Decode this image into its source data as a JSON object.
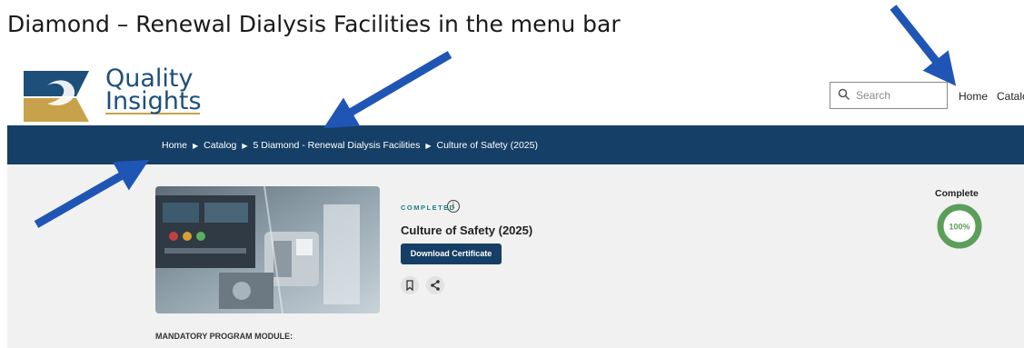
{
  "caption": "Diamond – Renewal Dialysis Facilities in the menu bar",
  "logo": {
    "line1": "Quality",
    "line2": "Insights"
  },
  "search": {
    "placeholder": "Search"
  },
  "nav": {
    "home": "Home",
    "catalog": "Catalo"
  },
  "breadcrumb": [
    "Home",
    "Catalog",
    "5 Diamond - Renewal Dialysis Facilities",
    "Culture of Safety (2025)"
  ],
  "course": {
    "status": "COMPLETED",
    "title": "Culture of Safety (2025)",
    "download_label": "Download Certificate"
  },
  "progress": {
    "label": "Complete",
    "value_text": "100%",
    "percent": 100
  },
  "section_heading": "MANDATORY PROGRAM MODULE:",
  "colors": {
    "brand_navy": "#153f66",
    "complete_green": "#5a9e5a",
    "arrow_blue": "#1f56b5"
  },
  "icons": [
    "search-icon",
    "info-icon",
    "bookmark-icon",
    "share-icon",
    "arrow-annotation"
  ]
}
